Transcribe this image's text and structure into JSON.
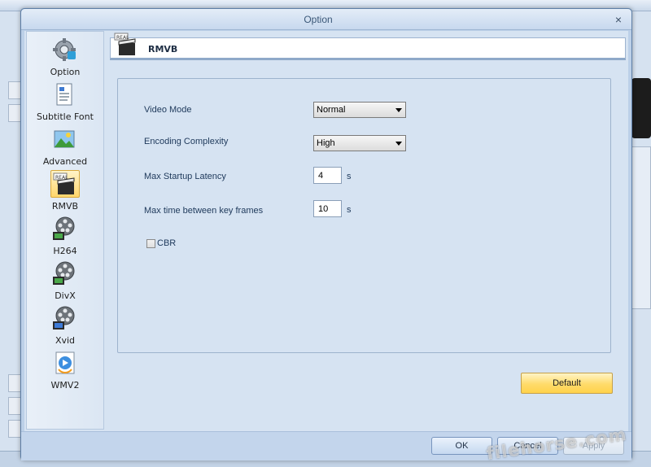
{
  "dialog": {
    "title": "Option",
    "close_label": "×"
  },
  "sidebar": {
    "items": [
      {
        "label": "Option",
        "icon": "settings-gear-icon"
      },
      {
        "label": "Subtitle Font",
        "icon": "document-text-icon"
      },
      {
        "label": "Advanced",
        "icon": "picture-icon"
      },
      {
        "label": "RMVB",
        "icon": "real-clapper-icon",
        "selected": true
      },
      {
        "label": "H264",
        "icon": "film-reel-icon"
      },
      {
        "label": "DivX",
        "icon": "film-reel-icon"
      },
      {
        "label": "Xvid",
        "icon": "film-reel-icon"
      },
      {
        "label": "WMV2",
        "icon": "media-player-icon"
      }
    ]
  },
  "header": {
    "title": "RMVB",
    "icon": "real-clapper-icon"
  },
  "form": {
    "video_mode_label": "Video Mode",
    "video_mode_value": "Normal",
    "encoding_complexity_label": "Encoding Complexity",
    "encoding_complexity_value": "High",
    "max_startup_latency_label": "Max Startup Latency",
    "max_startup_latency_value": "4",
    "max_startup_latency_unit": "s",
    "max_keyframe_label": "Max time between key frames",
    "max_keyframe_value": "10",
    "max_keyframe_unit": "s",
    "cbr_label": "CBR",
    "cbr_checked": false
  },
  "buttons": {
    "default": "Default",
    "ok": "OK",
    "cancel": "Cancel",
    "apply": "Apply"
  },
  "watermark": "filehorse.com",
  "colors": {
    "accent": "#ffd66b",
    "dialog_bg": "#d6e3f2",
    "text": "#1e395b"
  }
}
